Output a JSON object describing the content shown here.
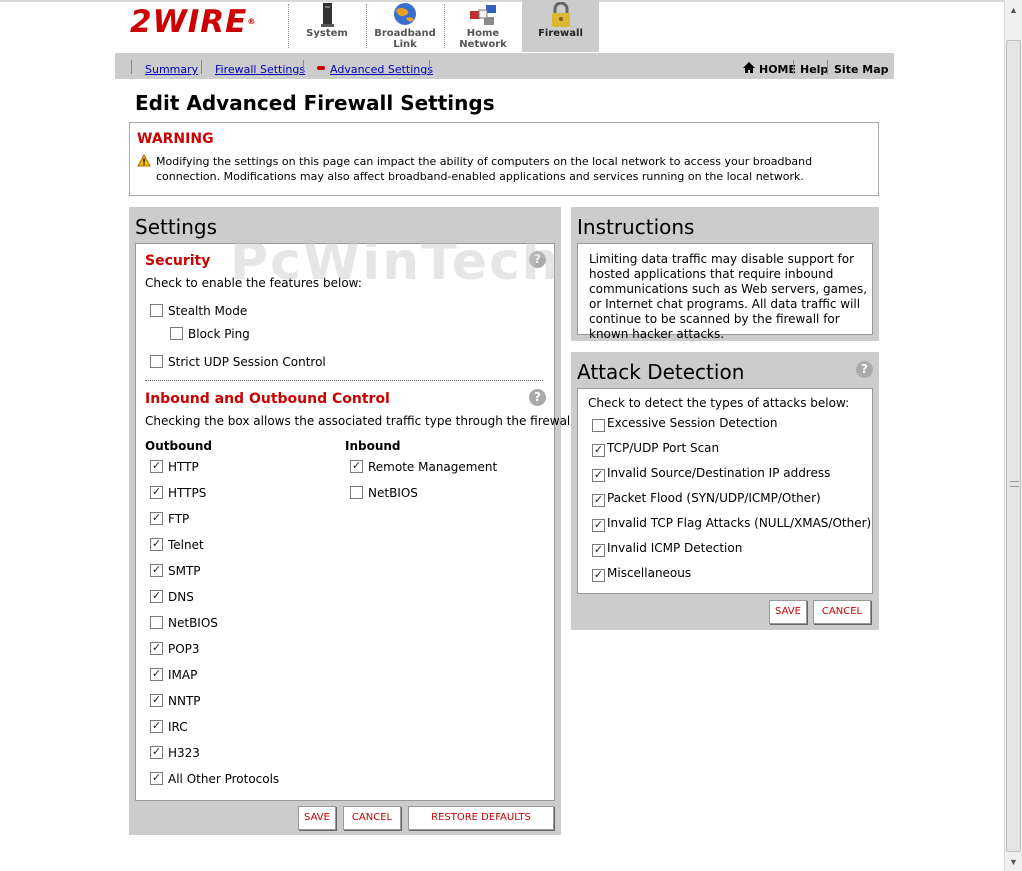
{
  "header": {
    "logo_text": "2WIRE",
    "logo_mark": "®",
    "nav": [
      {
        "label_line1": "System",
        "label_line2": "",
        "icon": "tower-icon"
      },
      {
        "label_line1": "Broadband",
        "label_line2": "Link",
        "icon": "globe-icon"
      },
      {
        "label_line1": "Home",
        "label_line2": "Network",
        "icon": "network-icon"
      },
      {
        "label_line1": "Firewall",
        "label_line2": "",
        "icon": "lock-icon"
      }
    ]
  },
  "subnav": {
    "links": [
      "Summary",
      "Firewall Settings",
      "Advanced Settings"
    ],
    "home": "HOME",
    "help": "Help",
    "sitemap": "Site Map"
  },
  "page_title": "Edit Advanced Firewall Settings",
  "warning": {
    "title": "WARNING",
    "text": "Modifying the settings on this page can impact the ability of computers on the local network to access your broadband connection. Modifications may also affect broadband-enabled applications and services running on the local network."
  },
  "watermark": "PcWinTech",
  "settings": {
    "title": "Settings",
    "security": {
      "title": "Security",
      "desc": "Check to enable the features below:",
      "options": [
        {
          "label": "Stealth Mode",
          "checked": false
        },
        {
          "label": "Block Ping",
          "checked": false
        },
        {
          "label": "Strict UDP Session Control",
          "checked": false
        }
      ]
    },
    "inout": {
      "title": "Inbound and Outbound Control",
      "desc": "Checking the box allows the associated traffic type through the firewall.",
      "outbound_label": "Outbound",
      "inbound_label": "Inbound",
      "outbound": [
        {
          "label": "HTTP",
          "checked": true
        },
        {
          "label": "HTTPS",
          "checked": true
        },
        {
          "label": "FTP",
          "checked": true
        },
        {
          "label": "Telnet",
          "checked": true
        },
        {
          "label": "SMTP",
          "checked": true
        },
        {
          "label": "DNS",
          "checked": true
        },
        {
          "label": "NetBIOS",
          "checked": false
        },
        {
          "label": "POP3",
          "checked": true
        },
        {
          "label": "IMAP",
          "checked": true
        },
        {
          "label": "NNTP",
          "checked": true
        },
        {
          "label": "IRC",
          "checked": true
        },
        {
          "label": "H323",
          "checked": true
        },
        {
          "label": "All Other Protocols",
          "checked": true
        }
      ],
      "inbound": [
        {
          "label": "Remote Management",
          "checked": true
        },
        {
          "label": "NetBIOS",
          "checked": false
        }
      ]
    },
    "buttons": {
      "save": "SAVE",
      "cancel": "CANCEL",
      "restore": "RESTORE DEFAULTS"
    }
  },
  "instructions": {
    "title": "Instructions",
    "text": "Limiting data traffic may disable support for hosted applications that require inbound communications such as Web servers, games, or Internet chat programs. All data traffic will continue to be scanned by the firewall for known hacker attacks."
  },
  "attack": {
    "title": "Attack Detection",
    "desc": "Check to detect the types of attacks below:",
    "options": [
      {
        "label": "Excessive Session Detection",
        "checked": false
      },
      {
        "label": "TCP/UDP Port Scan",
        "checked": true
      },
      {
        "label": "Invalid Source/Destination IP address",
        "checked": true
      },
      {
        "label": "Packet Flood (SYN/UDP/ICMP/Other)",
        "checked": true
      },
      {
        "label": "Invalid TCP Flag Attacks (NULL/XMAS/Other)",
        "checked": true
      },
      {
        "label": "Invalid ICMP Detection",
        "checked": true
      },
      {
        "label": "Miscellaneous",
        "checked": true
      }
    ],
    "buttons": {
      "save": "SAVE",
      "cancel": "CANCEL"
    }
  },
  "help_glyph": "?",
  "check_glyph": "✓",
  "colors": {
    "accent": "#cc0000",
    "panel": "#cccccc",
    "link": "#0000bb"
  }
}
